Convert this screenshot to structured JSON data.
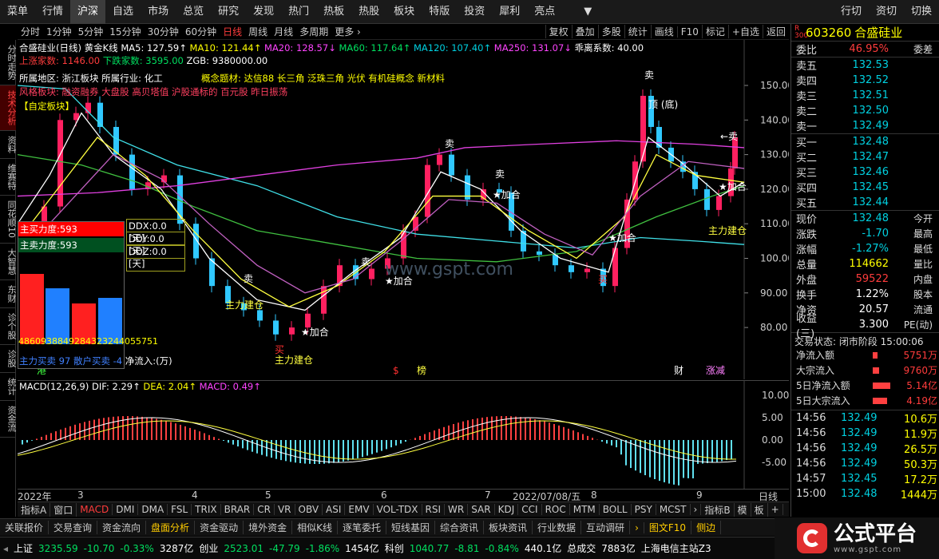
{
  "topbar": {
    "menu": "菜单",
    "items": [
      "行情",
      "沪深",
      "自选",
      "市场",
      "总览",
      "研究",
      "发现",
      "热门",
      "热板",
      "热股",
      "板块",
      "特版",
      "投资",
      "犀利",
      "亮点"
    ],
    "active_index": 1,
    "right_items": [
      "行切",
      "资切",
      "切换"
    ],
    "dropdown": "▼"
  },
  "toolbar": {
    "items": [
      "分时",
      "1分钟",
      "5分钟",
      "15分钟",
      "30分钟",
      "60分钟",
      "日线",
      "周线",
      "月线",
      "多周期",
      "更多 ›"
    ],
    "active_index": 6,
    "right_items": [
      "复权",
      "叠加",
      "多股",
      "统计",
      "画线",
      "F10",
      "标记",
      "+自选",
      "返回"
    ]
  },
  "leftnav": [
    "分时走势",
    "技术分析",
    "资料",
    "维赛特",
    "同花顺10",
    "大智慧",
    "东财",
    "诊个股",
    "诊股",
    "统计",
    "资金流"
  ],
  "leftnav_active": 1,
  "stock": {
    "name": "合盛硅业(日线)",
    "kline": "黄金K线",
    "ma5": "MA5: 127.59↑",
    "ma10": "MA10: 121.44↑",
    "ma20": "MA20: 128.57↓",
    "ma60": "MA60: 117.64↑",
    "ma120": "MA120: 107.40↑",
    "ma250": "MA250: 131.07↓",
    "ratio": "乖离系数: 40.00",
    "up_count": "上涨家数: 1146.00",
    "down_count": "下跌家数: 3595.00",
    "zgb": "ZGB: 9380000.00"
  },
  "concept": {
    "region": "所属地区: 浙江板块  所属行业: 化工",
    "concept": "概念题材: 达信88 长三角 泛珠三角 光伏 有机硅概念 新材料",
    "style": "风格板块: 融资融券 大盘股 高贝塔值 沪股通标的 百元股 昨日振荡",
    "custom": "【自定板块】"
  },
  "yaxis": [
    "150.00",
    "140.00",
    "130.00",
    "120.00",
    "110.00",
    "100.00",
    "90.00",
    "80.00"
  ],
  "annotations": {
    "sell": "卖",
    "buy": "买",
    "add": "★加合",
    "top": "顶 (底)",
    "main": "主力建仓",
    "arrow_left": "←卖"
  },
  "force": {
    "main_buy": "主买力度:593",
    "main_sell": "主卖力度:593",
    "ddx": "DDX:0.0 [天]",
    "ddy": "DDY:0.0 [天]",
    "ddz": "DDZ:0.0 [天]",
    "values": "4860938849284323244055751",
    "main_in": "主力买卖 97",
    "retail": "散户买卖 -4",
    "unit": "净流入:(万)"
  },
  "flags": {
    "f1": "港",
    "f2": "$",
    "f3": "榜",
    "f4": "财",
    "f5": "涨减"
  },
  "macd": {
    "label": "MACD(12,26,9)",
    "dif": "DIF: 2.29↑",
    "dea": "DEA: 2.04↑",
    "macd": "MACD: 0.49↑",
    "yaxis": [
      "10.00",
      "5.00",
      "0.00",
      "-5.00"
    ]
  },
  "xaxis": {
    "labels": [
      "2022年",
      "3",
      "4",
      "5",
      "6",
      "7",
      "2022/07/08/五",
      "8",
      "9"
    ],
    "period": "日线"
  },
  "bottomtabs": [
    "指标A",
    "窗口",
    "MACD",
    "DMI",
    "DMA",
    "FSL",
    "TRIX",
    "BRAR",
    "CR",
    "VR",
    "OBV",
    "ASI",
    "EMV",
    "VOL-TDX",
    "RSI",
    "WR",
    "SAR",
    "KDJ",
    "CCI",
    "ROC",
    "MTM",
    "BOLL",
    "PSY",
    "MCST",
    "›",
    "指标B",
    "模",
    "板",
    "+"
  ],
  "funcbar": [
    "关联报价",
    "交易查询",
    "资金流向",
    "盘面分析",
    "资金驱动",
    "境外资金",
    "相似K线",
    "逐笔委托",
    "短线基因",
    "综合资讯",
    "板块资讯",
    "行业数据",
    "互动调研",
    "›",
    "图文F10",
    "侧边"
  ],
  "statusbar": {
    "sh_label": "上证",
    "sh_val": "3235.59",
    "sh_chg": "-10.70",
    "sh_pct": "-0.33%",
    "sh_amt": "3287亿",
    "cy_label": "创业",
    "cy_val": "2523.01",
    "cy_chg": "-47.79",
    "cy_pct": "-1.86%",
    "cy_amt": "1454亿",
    "kc_label": "科创",
    "kc_val": "1040.77",
    "kc_chg": "-8.81",
    "kc_pct": "-0.84%",
    "kc_amt": "440.1亿",
    "total_label": "总成交",
    "total": "7883亿",
    "server": "上海电信主站Z3"
  },
  "logo": {
    "text": "公式平台",
    "url": "www.gspt.com"
  },
  "watermark": "www.gspt.com",
  "quote": {
    "code": "603260",
    "name": "合盛硅业",
    "code_prefix": "R 300",
    "weibi_label": "委比",
    "weibi": "46.95%",
    "weicha_label": "委差",
    "asks": [
      {
        "l": "卖五",
        "v": "132.53",
        "t": "¥"
      },
      {
        "l": "卖四",
        "v": "132.52"
      },
      {
        "l": "卖三",
        "v": "132.51"
      },
      {
        "l": "卖二",
        "v": "132.50"
      },
      {
        "l": "卖一",
        "v": "132.49"
      }
    ],
    "bids": [
      {
        "l": "买一",
        "v": "132.48"
      },
      {
        "l": "买二",
        "v": "132.47"
      },
      {
        "l": "买三",
        "v": "132.46"
      },
      {
        "l": "买四",
        "v": "132.45"
      },
      {
        "l": "买五",
        "v": "132.44"
      }
    ],
    "stats": [
      {
        "l": "现价",
        "v": "132.48",
        "c": "cyan",
        "l2": "今开"
      },
      {
        "l": "涨跌",
        "v": "-1.70",
        "c": "cyan",
        "l2": "最高"
      },
      {
        "l": "涨幅",
        "v": "-1.27%",
        "c": "cyan",
        "l2": "最低"
      },
      {
        "l": "总量",
        "v": "114662",
        "c": "yellow",
        "l2": "量比"
      },
      {
        "l": "外盘",
        "v": "59522",
        "c": "red",
        "l2": "内盘"
      },
      {
        "l": "换手",
        "v": "1.22%",
        "c": "white",
        "l2": "股本"
      },
      {
        "l": "净资",
        "v": "20.57",
        "c": "white",
        "l2": "流通"
      },
      {
        "l": "收益(三)",
        "v": "3.300",
        "c": "white",
        "l2": "PE(动)"
      }
    ],
    "trade_state": "交易状态: 闭市阶段 15:00:06",
    "flows": [
      {
        "l": "净流入额",
        "v": "5751万",
        "w": 6
      },
      {
        "l": "大宗流入",
        "v": "9760万",
        "w": 8
      },
      {
        "l": "5日净流入额",
        "v": "5.14亿",
        "w": 22
      },
      {
        "l": "5日大宗流入",
        "v": "4.19亿",
        "w": 18
      }
    ],
    "ticks": [
      {
        "t": "14:56",
        "p": "132.49",
        "v": "10.6万"
      },
      {
        "t": "14:56",
        "p": "132.49",
        "v": "11.9万"
      },
      {
        "t": "14:56",
        "p": "132.49",
        "v": "26.5万"
      },
      {
        "t": "14:56",
        "p": "132.49",
        "v": "50.3万"
      },
      {
        "t": "14:57",
        "p": "132.45",
        "v": "17.2万"
      },
      {
        "t": "15:00",
        "p": "132.48",
        "v": "1444万"
      }
    ]
  }
}
